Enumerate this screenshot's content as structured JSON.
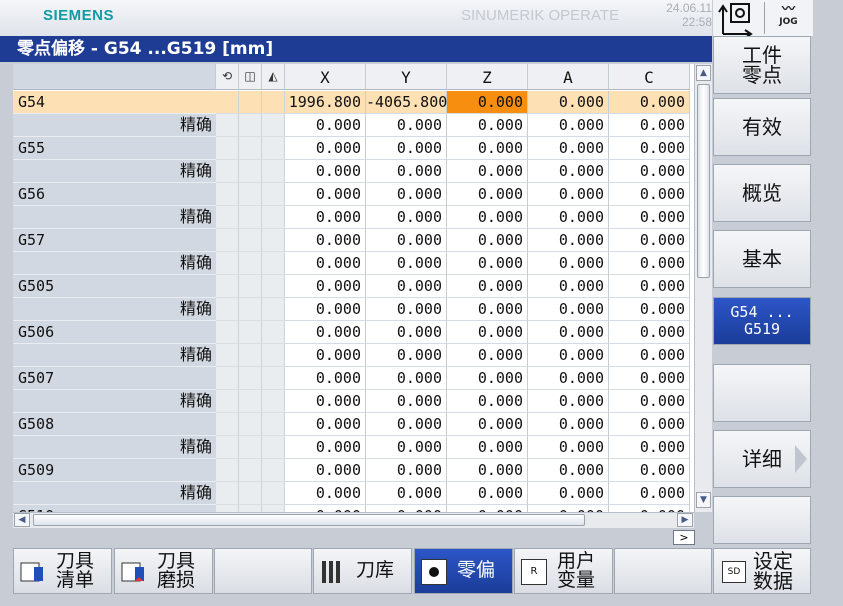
{
  "header": {
    "brand": "SIEMENS",
    "product": "SINUMERIK OPERATE",
    "date": "24.06.11",
    "time": "22:58",
    "mode": "JOG"
  },
  "title": "零点偏移 - G54 ...G519 [mm]",
  "table": {
    "columns": [
      "X",
      "Y",
      "Z",
      "A",
      "C"
    ],
    "rows": [
      {
        "label": "G54",
        "kind": "g",
        "values": [
          "1996.800",
          "-4065.800",
          "0.000",
          "0.000",
          "0.000"
        ],
        "selected": true
      },
      {
        "label": "精确",
        "kind": "f",
        "values": [
          "0.000",
          "0.000",
          "0.000",
          "0.000",
          "0.000"
        ]
      },
      {
        "label": "G55",
        "kind": "g",
        "values": []
      },
      {
        "label": "",
        "kind": "f",
        "values": [
          "0.000",
          "0.000",
          "0.000",
          "0.000",
          "0.000"
        ]
      },
      {
        "label": "G56",
        "kind": "g",
        "values": [
          "0.000",
          "0.000",
          "0.000",
          "0.000",
          "0.000"
        ]
      },
      {
        "label": "精确",
        "kind": "f",
        "values": [
          "0.000",
          "0.000",
          "0.000",
          "0.000",
          "0.000"
        ]
      },
      {
        "label": "G57",
        "kind": "g",
        "values": []
      },
      {
        "label": "",
        "kind": "f",
        "values": [
          "0.000",
          "0.000",
          "0.000",
          "0.000",
          "0.000"
        ]
      }
    ]
  },
  "softkeys_right": [
    {
      "line1": "工件",
      "line2": "零点"
    },
    {
      "line1": "有效",
      "line2": ""
    },
    {
      "line1": "概览",
      "line2": ""
    },
    {
      "line1": "基本",
      "line2": ""
    },
    {
      "line1": "G54 ...",
      "line2": "G519",
      "active": true
    },
    {
      "line1": "",
      "line2": ""
    },
    {
      "line1": "详细",
      "line2": "",
      "arrow": true
    },
    {
      "line1": "",
      "line2": ""
    },
    {
      "line1": "设定",
      "line2": "数据",
      "icon": "SD"
    }
  ],
  "softkeys_bottom": [
    {
      "line1": "刀具",
      "line2": "清单"
    },
    {
      "line1": "刀具",
      "line2": "磨损"
    },
    {
      "line1": "",
      "line2": ""
    },
    {
      "line1": "刀库",
      "line2": ""
    },
    {
      "line1": "零偏",
      "line2": "",
      "active": true
    },
    {
      "line1": "用户",
      "line2": "变量",
      "icon": "R"
    },
    {
      "line1": "",
      "line2": ""
    }
  ],
  "colors": {
    "title_bg": "#1f3c95",
    "selected_row": "#fde0b4",
    "active_cell": "#f78e10",
    "brand": "#0f9ca3"
  }
}
